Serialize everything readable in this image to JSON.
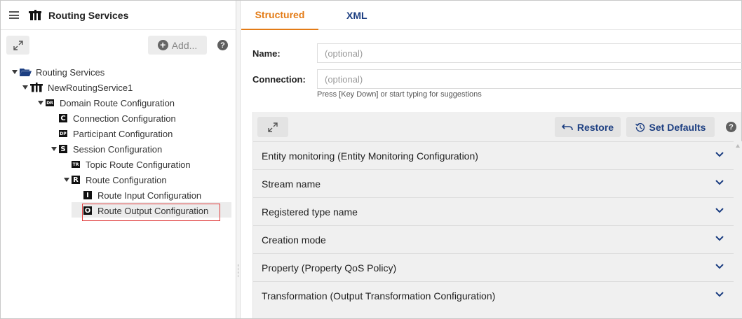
{
  "left": {
    "title": "Routing Services",
    "add_label": "Add...",
    "help": "?",
    "tree": [
      {
        "label": "Routing Services",
        "icon": "folder-icon"
      },
      {
        "label": "NewRoutingService1",
        "icon": "routing-service-icon"
      },
      {
        "label": "Domain Route Configuration",
        "badge": "DR"
      },
      {
        "label": "Connection Configuration",
        "badge": "C"
      },
      {
        "label": "Participant Configuration",
        "badge": "DP"
      },
      {
        "label": "Session Configuration",
        "badge": "S"
      },
      {
        "label": "Topic Route Configuration",
        "badge": "TR"
      },
      {
        "label": "Route Configuration",
        "badge": "R"
      },
      {
        "label": "Route Input Configuration",
        "badge": "I"
      },
      {
        "label": "Route Output Configuration",
        "badge": "O"
      }
    ]
  },
  "right": {
    "tabs": [
      {
        "label": "Structured",
        "active": true
      },
      {
        "label": "XML",
        "active": false
      }
    ],
    "form": {
      "name_label": "Name:",
      "name_placeholder": "(optional)",
      "connection_label": "Connection:",
      "connection_placeholder": "(optional)",
      "hint": "Press [Key Down] or start typing for suggestions"
    },
    "toolbar": {
      "restore_label": "Restore",
      "defaults_label": "Set Defaults",
      "help": "?"
    },
    "sections": [
      "Entity monitoring (Entity Monitoring Configuration)",
      "Stream name",
      "Registered type name",
      "Creation mode",
      "Property (Property QoS Policy)",
      "Transformation (Output Transformation Configuration)"
    ]
  },
  "colors": {
    "accent_tab": "#e37b16",
    "link_blue": "#1d3f82",
    "selection_border": "#e03a3a"
  }
}
